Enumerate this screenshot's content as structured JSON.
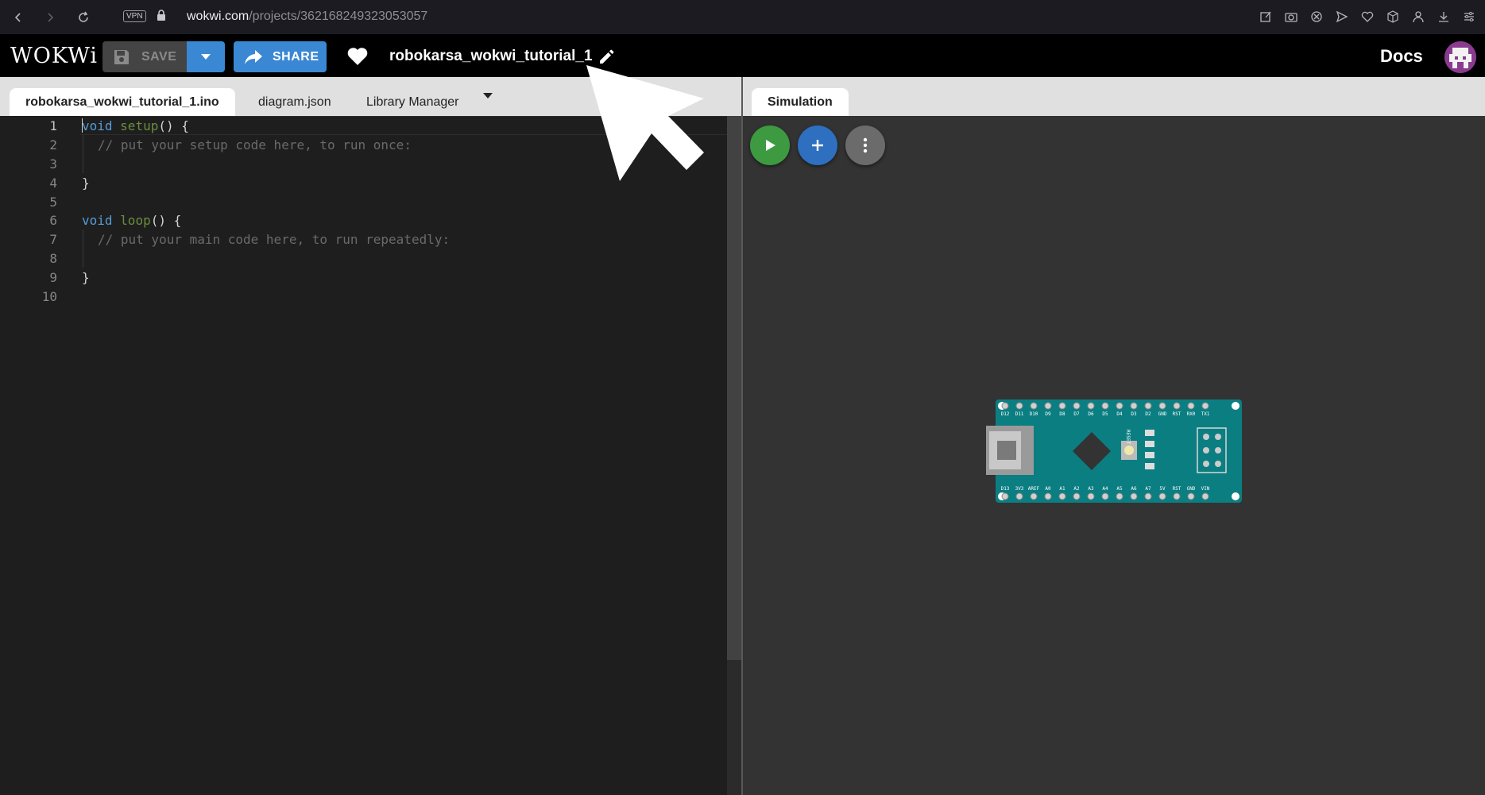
{
  "browser": {
    "url_host": "wokwi.com",
    "url_path": "/projects/362168249323053057",
    "vpn_label": "VPN"
  },
  "header": {
    "logo": "WOKWi",
    "save_label": "SAVE",
    "share_label": "SHARE",
    "project_name": "robokarsa_wokwi_tutorial_1",
    "docs_label": "Docs"
  },
  "editor": {
    "tabs": [
      {
        "label": "robokarsa_wokwi_tutorial_1.ino"
      },
      {
        "label": "diagram.json"
      },
      {
        "label": "Library Manager"
      }
    ],
    "lines": [
      {
        "no": "1"
      },
      {
        "no": "2"
      },
      {
        "no": "3"
      },
      {
        "no": "4"
      },
      {
        "no": "5"
      },
      {
        "no": "6"
      },
      {
        "no": "7"
      },
      {
        "no": "8"
      },
      {
        "no": "9"
      },
      {
        "no": "10"
      }
    ],
    "code": {
      "kw_void": "void",
      "fn_setup": "setup",
      "fn_loop": "loop",
      "open_paren": "() {",
      "close_brace": "}",
      "comment_setup": "// put your setup code here, to run once:",
      "comment_loop": "// put your main code here, to run repeatedly:"
    }
  },
  "simulation": {
    "tab_label": "Simulation",
    "board": {
      "top_pins": [
        "D12",
        "D11",
        "D10",
        "D9",
        "D8",
        "D7",
        "D6",
        "D5",
        "D4",
        "D3",
        "D2",
        "GND",
        "RST",
        "RX0",
        "TX1"
      ],
      "bottom_pins": [
        "D13",
        "3V3",
        "AREF",
        "A0",
        "A1",
        "A2",
        "A3",
        "A4",
        "A5",
        "A6",
        "A7",
        "5V",
        "RST",
        "GND",
        "VIN"
      ],
      "reset_label": "RESET",
      "led_labels": [
        "TX",
        "RX",
        "ON",
        "L"
      ]
    }
  },
  "colors": {
    "save_dropdown": "#3a87d4",
    "share": "#3a87d4",
    "play": "#3d9a41",
    "add": "#2f6fbf",
    "board": "#0b7e82"
  }
}
